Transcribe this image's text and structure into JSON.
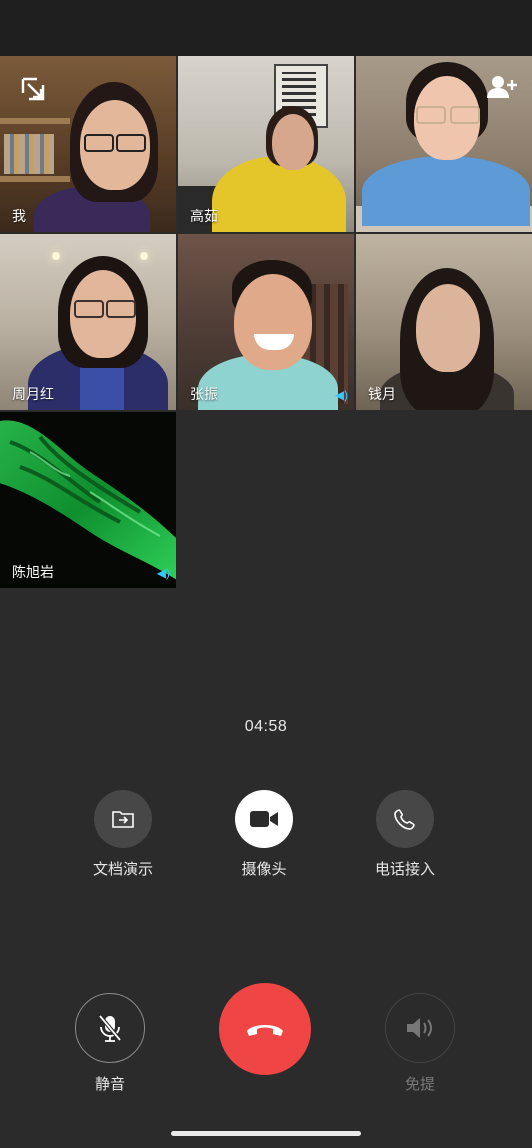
{
  "participants": [
    {
      "name": "我"
    },
    {
      "name": "高茹"
    },
    {
      "name": ""
    },
    {
      "name": "周月红"
    },
    {
      "name": "张振"
    },
    {
      "name": "钱月"
    },
    {
      "name": "陈旭岩"
    }
  ],
  "call": {
    "duration": "04:58"
  },
  "controls": {
    "doc_share": "文档演示",
    "camera": "摄像头",
    "phone_in": "电话接入",
    "mute": "静音",
    "speaker": "免提"
  },
  "colors": {
    "hangup": "#f04545",
    "accent_signal": "#39c6ff"
  },
  "icons": [
    "minimize-icon",
    "add-person-icon",
    "folder-share-icon",
    "video-camera-icon",
    "phone-icon",
    "mic-off-icon",
    "hang-up-icon",
    "speaker-icon"
  ]
}
